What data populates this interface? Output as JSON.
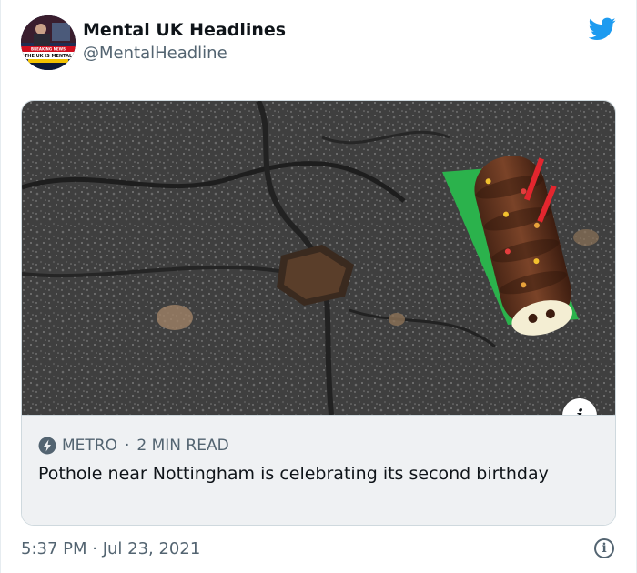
{
  "tweet": {
    "display_name": "Mental UK Headlines",
    "handle": "@MentalHeadline",
    "timestamp": "5:37 PM · Jul 23, 2021",
    "avatar": {
      "banner_small": "BREAKING NEWS",
      "banner_main": "THE UK IS MENTAL"
    }
  },
  "card": {
    "source": "METRO",
    "separator": "·",
    "read_time": "2 MIN READ",
    "title": "Pothole near Nottingham is celebrating its second birthday",
    "image_icon": "info-icon"
  },
  "icons": {
    "brand": "twitter-bird-icon",
    "card_source": "bolt-icon",
    "footer": "info-circle-icon"
  },
  "colors": {
    "twitter_blue": "#1d9bf0",
    "secondary_text": "#536471",
    "card_footer_bg": "#eff1f3"
  }
}
